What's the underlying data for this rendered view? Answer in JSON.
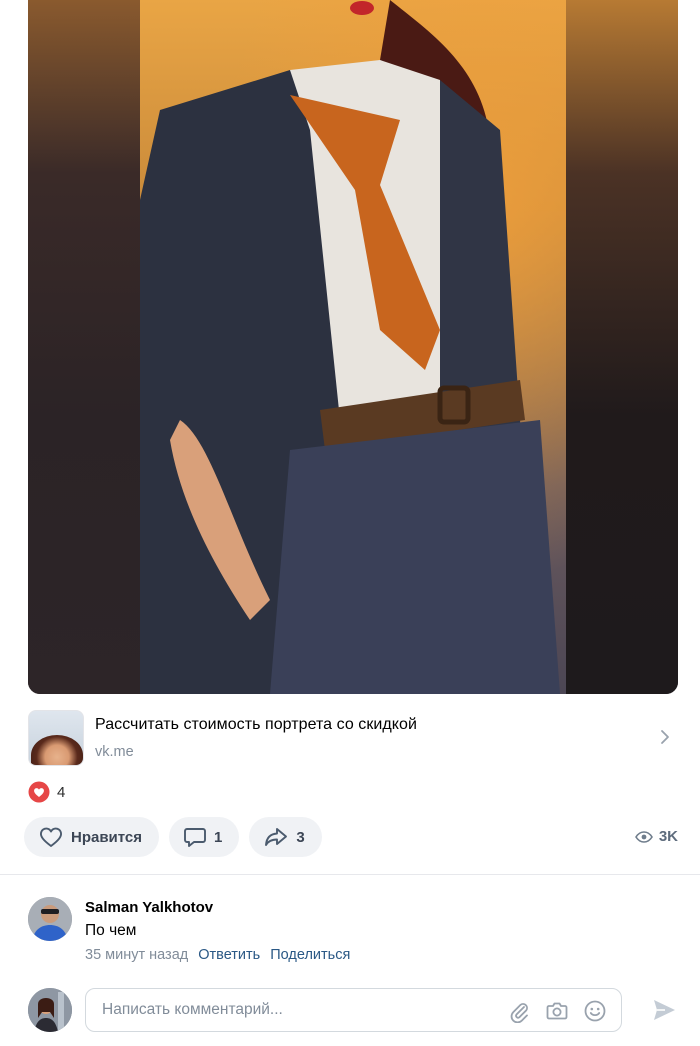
{
  "link_snippet": {
    "title": "Рассчитать стоимость портрета со скидкой",
    "domain": "vk.me"
  },
  "reactions": {
    "icon": "heart-reaction-icon",
    "count": "4",
    "color": "#e64646"
  },
  "actions": {
    "like_label": "Нравится",
    "comments_count": "1",
    "shares_count": "3",
    "views_count": "3K"
  },
  "comment": {
    "author": "Salman Yalkhotov",
    "text": "По чем",
    "time": "35 минут назад",
    "reply_label": "Ответить",
    "share_label": "Поделиться"
  },
  "compose": {
    "placeholder": "Написать комментарий..."
  },
  "colors": {
    "link": "#2a5885",
    "secondary_text": "#818c99",
    "pill_bg": "#f0f2f5",
    "divider": "#e7e8ec"
  }
}
